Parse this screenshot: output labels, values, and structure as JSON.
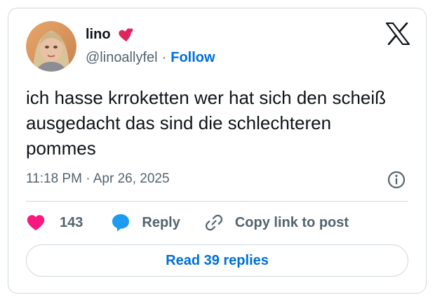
{
  "author": {
    "name": "lino",
    "name_emoji": "two-hearts",
    "handle": "@linoallyfel",
    "separator": "·",
    "follow_label": "Follow",
    "avatar": "avatar-photo"
  },
  "tweet": {
    "text": "ich hasse krroketten wer hat sich den scheiß ausgedacht das sind die schlechteren pommes",
    "timestamp": "11:18 PM · Apr 26, 2025"
  },
  "actions": {
    "like_count": "143",
    "reply_label": "Reply",
    "copy_link_label": "Copy link to post"
  },
  "footer": {
    "read_replies_label": "Read 39 replies"
  },
  "icons": {
    "logo": "x-logo-icon",
    "info": "info-icon",
    "like": "heart-icon",
    "reply": "reply-bubble-icon",
    "copy": "link-icon"
  },
  "colors": {
    "text": "#0f1419",
    "secondary": "#536471",
    "link": "#006fd6",
    "like": "#f91880",
    "reply": "#1d9bf0",
    "border": "#cfd9de"
  }
}
